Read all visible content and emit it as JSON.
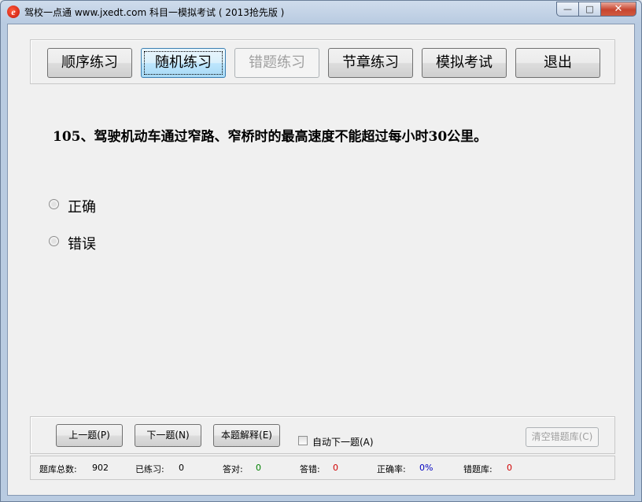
{
  "window": {
    "title": "驾校一点通 www.jxedt.com 科目一模拟考试 ( 2013抢先版 )",
    "app_icon_glyph": "e",
    "controls": {
      "minimize": "—",
      "maximize": "□",
      "close": "✕"
    }
  },
  "toolbar": {
    "buttons": [
      {
        "label": "顺序练习",
        "state": "normal"
      },
      {
        "label": "随机练习",
        "state": "active"
      },
      {
        "label": "错题练习",
        "state": "disabled"
      },
      {
        "label": "节章练习",
        "state": "normal"
      },
      {
        "label": "模拟考试",
        "state": "normal"
      },
      {
        "label": "退出",
        "state": "normal"
      }
    ]
  },
  "question": {
    "text": "105、驾驶机动车通过窄路、窄桥时的最高速度不能超过每小时30公里。",
    "options": [
      "正确",
      "错误"
    ]
  },
  "nav": {
    "prev": "上一题(P)",
    "next": "下一题(N)",
    "explain": "本题解释(E)",
    "auto_next": "自动下一题(A)",
    "auto_next_checked": false,
    "clear_wrong": "清空错题库(C)"
  },
  "status": {
    "total_label": "题库总数:",
    "total_value": "902",
    "practiced_label": "已练习:",
    "practiced_value": "0",
    "correct_label": "答对:",
    "correct_value": "0",
    "wrong_label": "答错:",
    "wrong_value": "0",
    "rate_label": "正确率:",
    "rate_value": "0%",
    "wrongbank_label": "错题库:",
    "wrongbank_value": "0"
  },
  "colors": {
    "correct": "#008000",
    "wrong": "#d00000",
    "rate": "#0000c0",
    "wrongbank": "#d00000"
  }
}
